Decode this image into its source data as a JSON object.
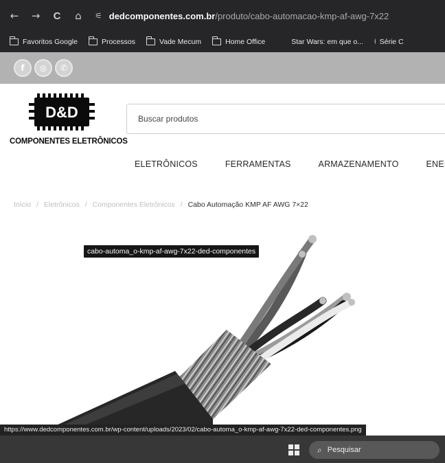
{
  "browser": {
    "nav": {
      "back": "←",
      "forward": "→",
      "reload": "C",
      "home": "⌂"
    },
    "url_host": "dedcomponentes.com.br",
    "url_path": "/produto/cabo-automacao-kmp-af-awg-7x22",
    "bookmarks": [
      "Favoritos Google",
      "Processos",
      "Vade Mecum",
      "Home Office",
      "Star Wars: em que o...",
      "Série C"
    ]
  },
  "site": {
    "social": [
      "f",
      "◎",
      "✆"
    ],
    "logo_text": "COMPONENTES ELETRÔNICOS",
    "logo_mark": "D&D",
    "search_placeholder": "Buscar produtos",
    "menu": [
      "ELETRÔNICOS",
      "FERRAMENTAS",
      "ARMAZENAMENTO",
      "ENERG"
    ],
    "breadcrumb": {
      "items": [
        "Início",
        "Eletrônicos",
        "Componentes Eletrônicos"
      ],
      "separator": "/",
      "current": "Cabo Automação KMP AF AWG 7×22"
    },
    "image_tooltip": "cabo-automa_o-kmp-af-awg-7x22-ded-componentes"
  },
  "status_url": "https://www.dedcomponentes.com.br/wp-content/uploads/2023/02/cabo-automa_o-kmp-af-awg-7x22-ded-componentes.png",
  "taskbar": {
    "search_label": "Pesquisar"
  }
}
